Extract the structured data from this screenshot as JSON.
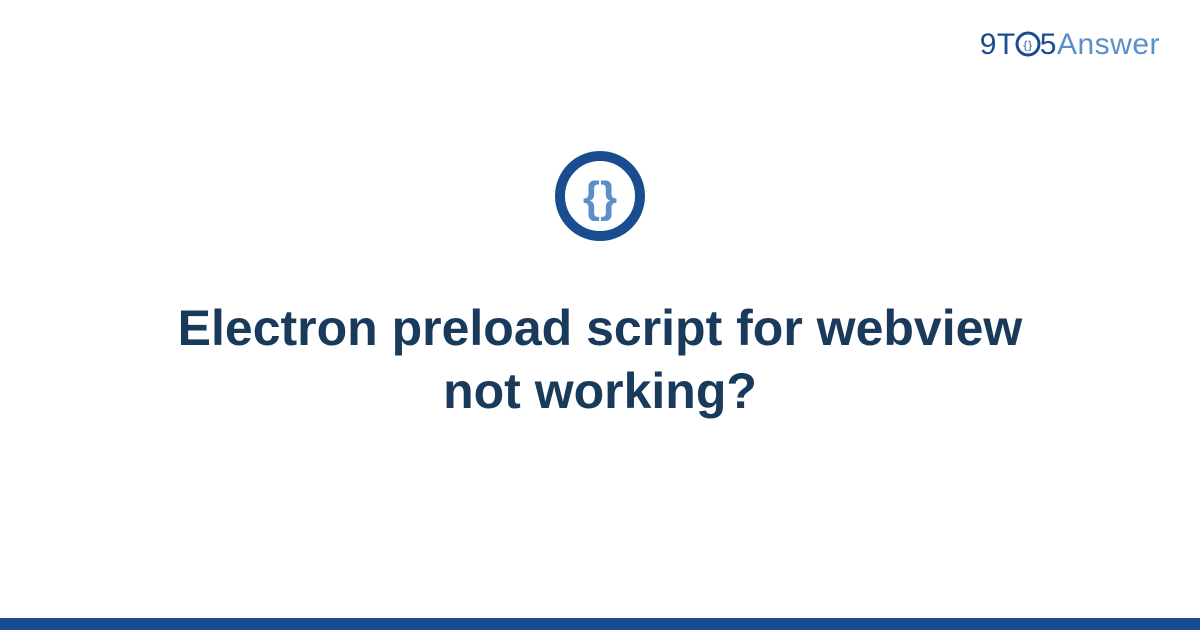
{
  "brand": {
    "prefix": "9T",
    "suffix": "5",
    "word": "Answer"
  },
  "title": "Electron preload script for webview not working?",
  "icon": {
    "name": "curly-braces-icon"
  },
  "colors": {
    "dark_blue": "#1a4d8f",
    "light_blue": "#5a8fc7",
    "text": "#1a3a5c"
  }
}
